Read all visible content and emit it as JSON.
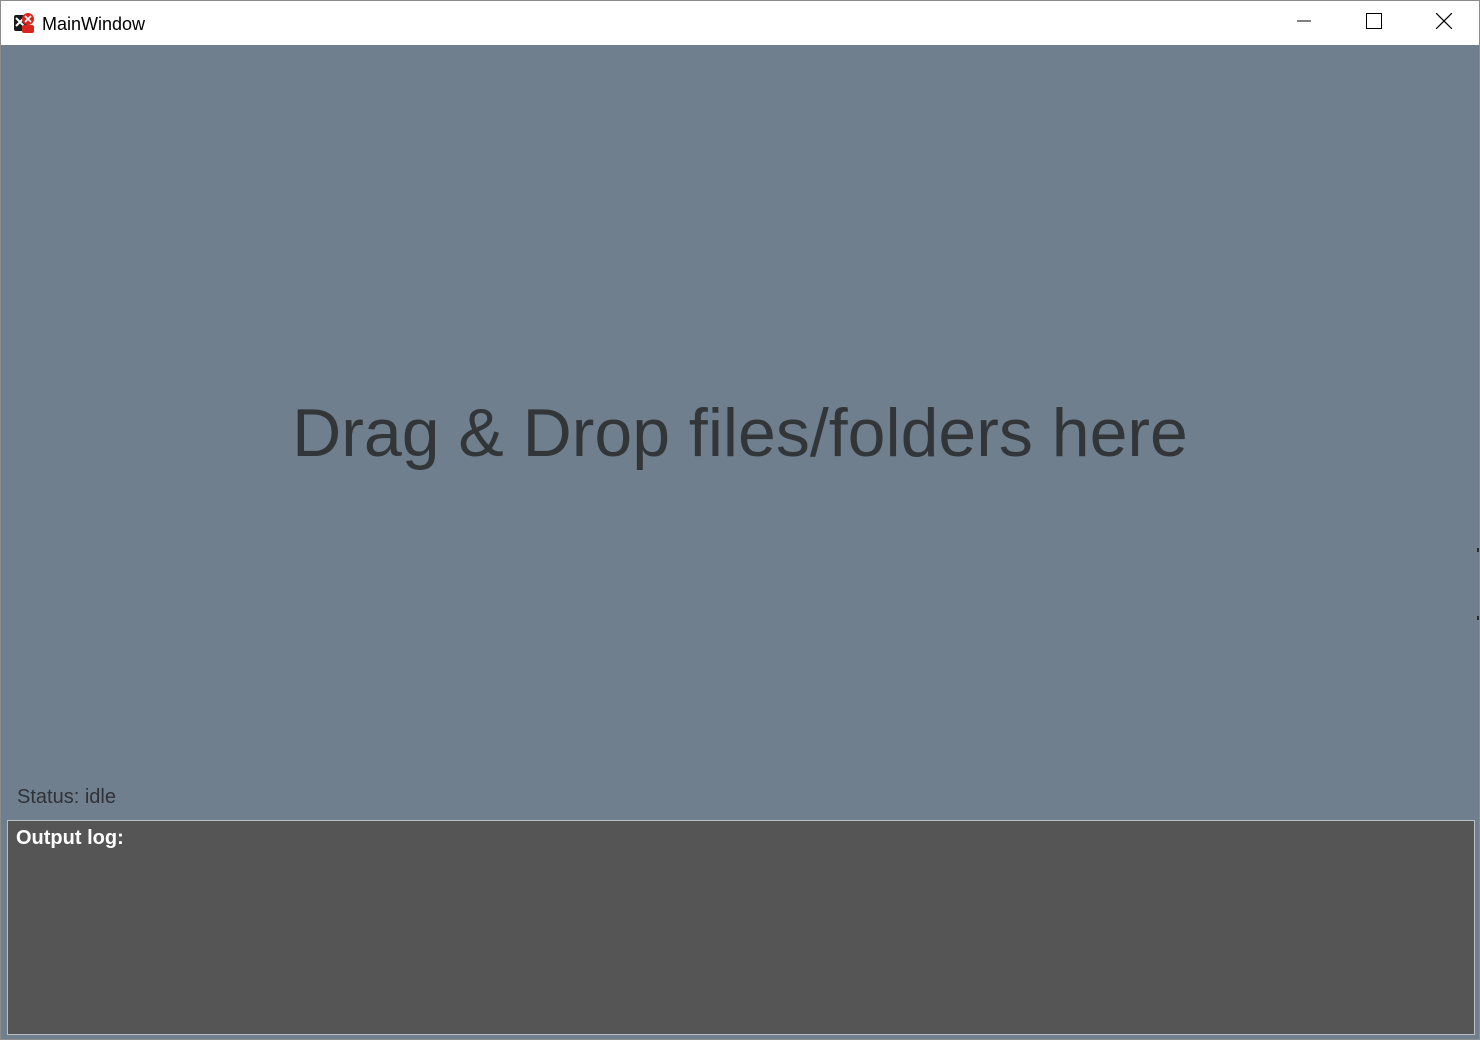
{
  "window": {
    "title": "MainWindow",
    "app_icon": "app-logo-icon",
    "controls": {
      "minimize": "minimize-icon",
      "maximize": "maximize-icon",
      "close": "close-icon"
    }
  },
  "drop_zone": {
    "message": "Drag & Drop files/folders here"
  },
  "status": {
    "text": "Status: idle"
  },
  "output_log": {
    "label": "Output log:"
  },
  "colors": {
    "background": "#707f8e",
    "log_background": "#555555",
    "drop_text": "#333638",
    "log_text": "#ffffff"
  }
}
